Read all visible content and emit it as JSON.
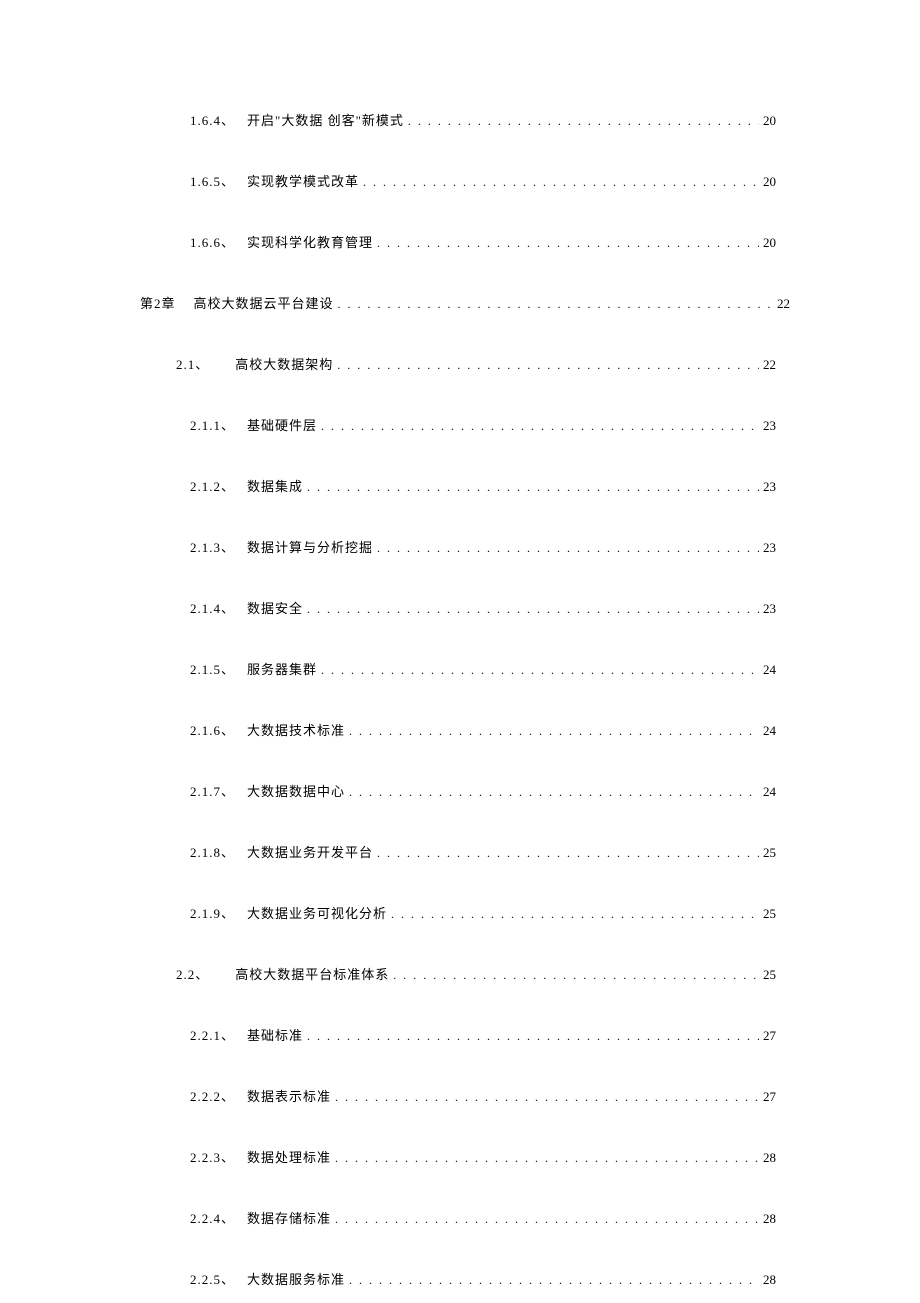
{
  "toc": [
    {
      "number": "1.6.4、",
      "title": "开启\"大数据 创客\"新模式",
      "page": "20",
      "indent": 2
    },
    {
      "number": "1.6.5、",
      "title": "实现教学模式改革",
      "page": "20",
      "indent": 2
    },
    {
      "number": "1.6.6、",
      "title": "实现科学化教育管理",
      "page": "20",
      "indent": 2
    },
    {
      "number": "第2章",
      "title": "高校大数据云平台建设",
      "page": "22",
      "indent": 0,
      "wide": true
    },
    {
      "number": "2.1、",
      "title": "高校大数据架构",
      "page": "22",
      "indent": 1
    },
    {
      "number": "2.1.1、",
      "title": "基础硬件层",
      "page": "23",
      "indent": 2
    },
    {
      "number": "2.1.2、",
      "title": "数据集成",
      "page": "23",
      "indent": 2
    },
    {
      "number": "2.1.3、",
      "title": "数据计算与分析挖掘",
      "page": "23",
      "indent": 2
    },
    {
      "number": "2.1.4、",
      "title": "数据安全",
      "page": "23",
      "indent": 2
    },
    {
      "number": "2.1.5、",
      "title": "服务器集群",
      "page": "24",
      "indent": 2
    },
    {
      "number": "2.1.6、",
      "title": "大数据技术标准",
      "page": "24",
      "indent": 2
    },
    {
      "number": "2.1.7、",
      "title": "大数据数据中心",
      "page": "24",
      "indent": 2
    },
    {
      "number": "2.1.8、",
      "title": "大数据业务开发平台",
      "page": "25",
      "indent": 2
    },
    {
      "number": "2.1.9、",
      "title": "大数据业务可视化分析",
      "page": "25",
      "indent": 2
    },
    {
      "number": "2.2、",
      "title": "高校大数据平台标准体系",
      "page": "25",
      "indent": 1
    },
    {
      "number": "2.2.1、",
      "title": "基础标准",
      "page": "27",
      "indent": 2
    },
    {
      "number": "2.2.2、",
      "title": "数据表示标准",
      "page": "27",
      "indent": 2
    },
    {
      "number": "2.2.3、",
      "title": "数据处理标准",
      "page": "28",
      "indent": 2
    },
    {
      "number": "2.2.4、",
      "title": "数据存储标准",
      "page": "28",
      "indent": 2
    },
    {
      "number": "2.2.5、",
      "title": "大数据服务标准",
      "page": "28",
      "indent": 2
    }
  ]
}
